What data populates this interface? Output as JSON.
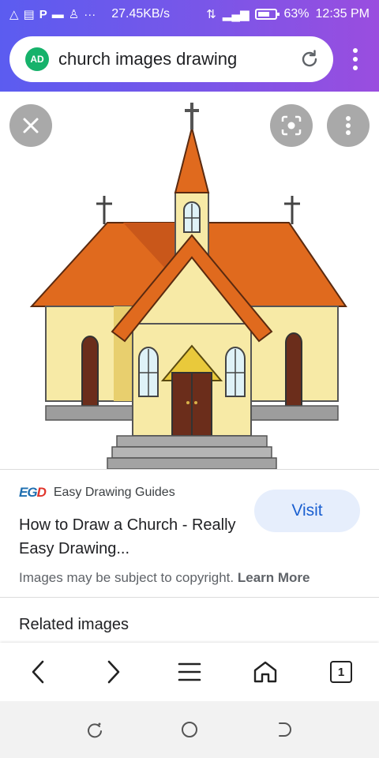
{
  "status_bar": {
    "speed": "27.45KB/s",
    "battery": "63%",
    "time": "12:35 PM"
  },
  "search": {
    "badge": "AD",
    "query": "church images drawing"
  },
  "result": {
    "site_name": "Easy Drawing Guides",
    "logo_text_a": "EG",
    "logo_text_b": "D",
    "title": "How to Draw a Church - Really Easy Drawing...",
    "visit_label": "Visit",
    "copyright_text": "Images may be subject to copyright.",
    "learn_more": "Learn More",
    "related_heading": "Related images"
  },
  "toolbar": {
    "tab_count": "1"
  },
  "colors": {
    "accent": "#1a5fd0",
    "header_start": "#5b5cf0",
    "header_end": "#9a4ddf",
    "roof": "#e06a1e",
    "wall": "#f7eaa6",
    "door": "#6b2d1b"
  }
}
